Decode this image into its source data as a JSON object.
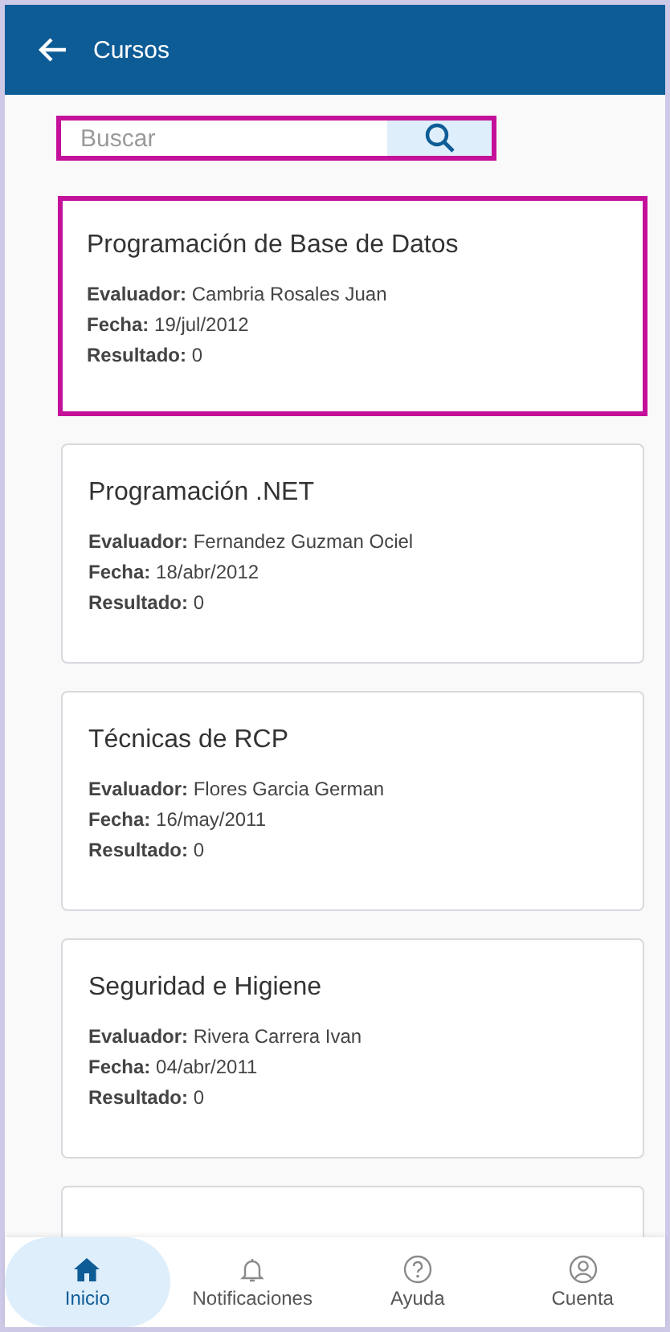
{
  "header": {
    "title": "Cursos"
  },
  "search": {
    "placeholder": "Buscar",
    "highlighted": true
  },
  "courses": [
    {
      "title": "Programación de Base de Datos",
      "fields": [
        {
          "label": "Evaluador:",
          "value": "Cambria Rosales Juan"
        },
        {
          "label": "Fecha:",
          "value": "19/jul/2012"
        },
        {
          "label": "Resultado:",
          "value": "0"
        }
      ],
      "highlighted": true
    },
    {
      "title": "Programación .NET",
      "fields": [
        {
          "label": "Evaluador:",
          "value": "Fernandez Guzman Ociel"
        },
        {
          "label": "Fecha:",
          "value": "18/abr/2012"
        },
        {
          "label": "Resultado:",
          "value": "0"
        }
      ],
      "highlighted": false
    },
    {
      "title": "Técnicas de RCP",
      "fields": [
        {
          "label": "Evaluador:",
          "value": "Flores Garcia German"
        },
        {
          "label": "Fecha:",
          "value": "16/may/2011"
        },
        {
          "label": "Resultado:",
          "value": "0"
        }
      ],
      "highlighted": false
    },
    {
      "title": "Seguridad e Higiene",
      "fields": [
        {
          "label": "Evaluador:",
          "value": "Rivera Carrera Ivan"
        },
        {
          "label": "Fecha:",
          "value": "04/abr/2011"
        },
        {
          "label": "Resultado:",
          "value": "0"
        }
      ],
      "highlighted": false
    }
  ],
  "bottom_nav": [
    {
      "label": "Inicio",
      "selected": true
    },
    {
      "label": "Notificaciones",
      "selected": false
    },
    {
      "label": "Ayuda",
      "selected": false
    },
    {
      "label": "Cuenta",
      "selected": false
    }
  ]
}
